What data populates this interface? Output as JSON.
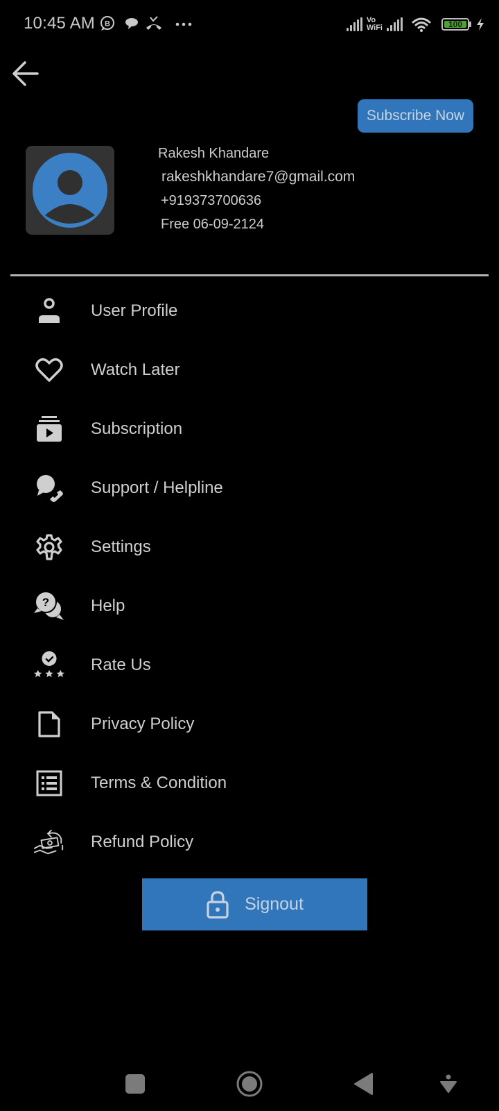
{
  "status_bar": {
    "time": "10:45 AM",
    "notification_icons": [
      "business-whatsapp-icon",
      "chat-bubble-icon",
      "missed-call-icon",
      "more-dots-icon"
    ],
    "vowifi_line1": "Vo",
    "vowifi_line2": "WiFi",
    "battery_percent": "100",
    "battery_level": 100,
    "charging": true
  },
  "header": {
    "back_icon": "arrow-left-icon",
    "subscribe_label": "Subscribe Now"
  },
  "profile": {
    "name": "Rakesh Khandare",
    "email": "rakeshkhandare7@gmail.com",
    "phone": "+919373700636",
    "plan": "Free 06-09-2124"
  },
  "menu": {
    "items": [
      {
        "label": "User Profile",
        "icon": "user-profile-icon"
      },
      {
        "label": "Watch Later",
        "icon": "heart-icon"
      },
      {
        "label": "Subscription",
        "icon": "subscription-icon"
      },
      {
        "label": "Support / Helpline",
        "icon": "support-icon"
      },
      {
        "label": "Settings",
        "icon": "gear-icon"
      },
      {
        "label": "Help",
        "icon": "help-chat-icon"
      },
      {
        "label": "Rate Us",
        "icon": "rate-us-icon"
      },
      {
        "label": "Privacy Policy",
        "icon": "document-icon"
      },
      {
        "label": "Terms & Condition",
        "icon": "list-icon"
      },
      {
        "label": "Refund Policy",
        "icon": "refund-icon"
      }
    ]
  },
  "signout": {
    "label": "Signout",
    "icon": "lock-icon"
  },
  "nav_bar": {
    "buttons": [
      "recents-square-icon",
      "home-circle-icon",
      "back-triangle-icon",
      "accessibility-icon"
    ]
  },
  "colors": {
    "accent": "#3176bb",
    "background": "#000000",
    "text": "#cfcfcf",
    "battery_green": "#4aa52e"
  }
}
